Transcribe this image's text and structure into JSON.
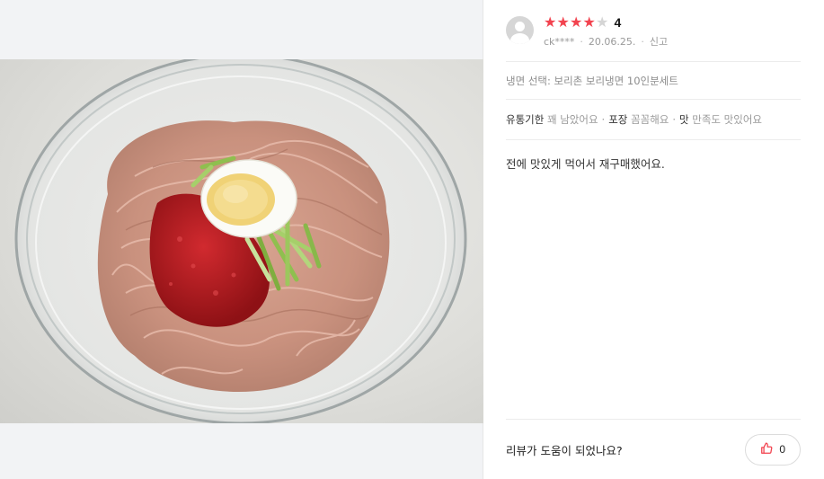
{
  "review": {
    "rating": 4,
    "rating_text": "4",
    "stars": [
      "on",
      "on",
      "on",
      "on",
      "off"
    ],
    "user": "ck****",
    "date": "20.06.25.",
    "report_label": "신고",
    "option_text": "냉면 선택: 보리촌 보리냉면 10인분세트",
    "summary": [
      {
        "key": "유통기한",
        "value": "꽤 남았어요"
      },
      {
        "key": "포장",
        "value": "꼼꼼해요"
      },
      {
        "key": "맛",
        "value": "만족도 맛있어요"
      }
    ],
    "body": "전에 맛있게 먹어서 재구매했어요."
  },
  "footer": {
    "question": "리뷰가 도움이 되었나요?",
    "like_count": "0"
  },
  "colors": {
    "star_on": "#f2434f",
    "star_off": "#d5d5d5",
    "like_icon": "#f2434f"
  }
}
